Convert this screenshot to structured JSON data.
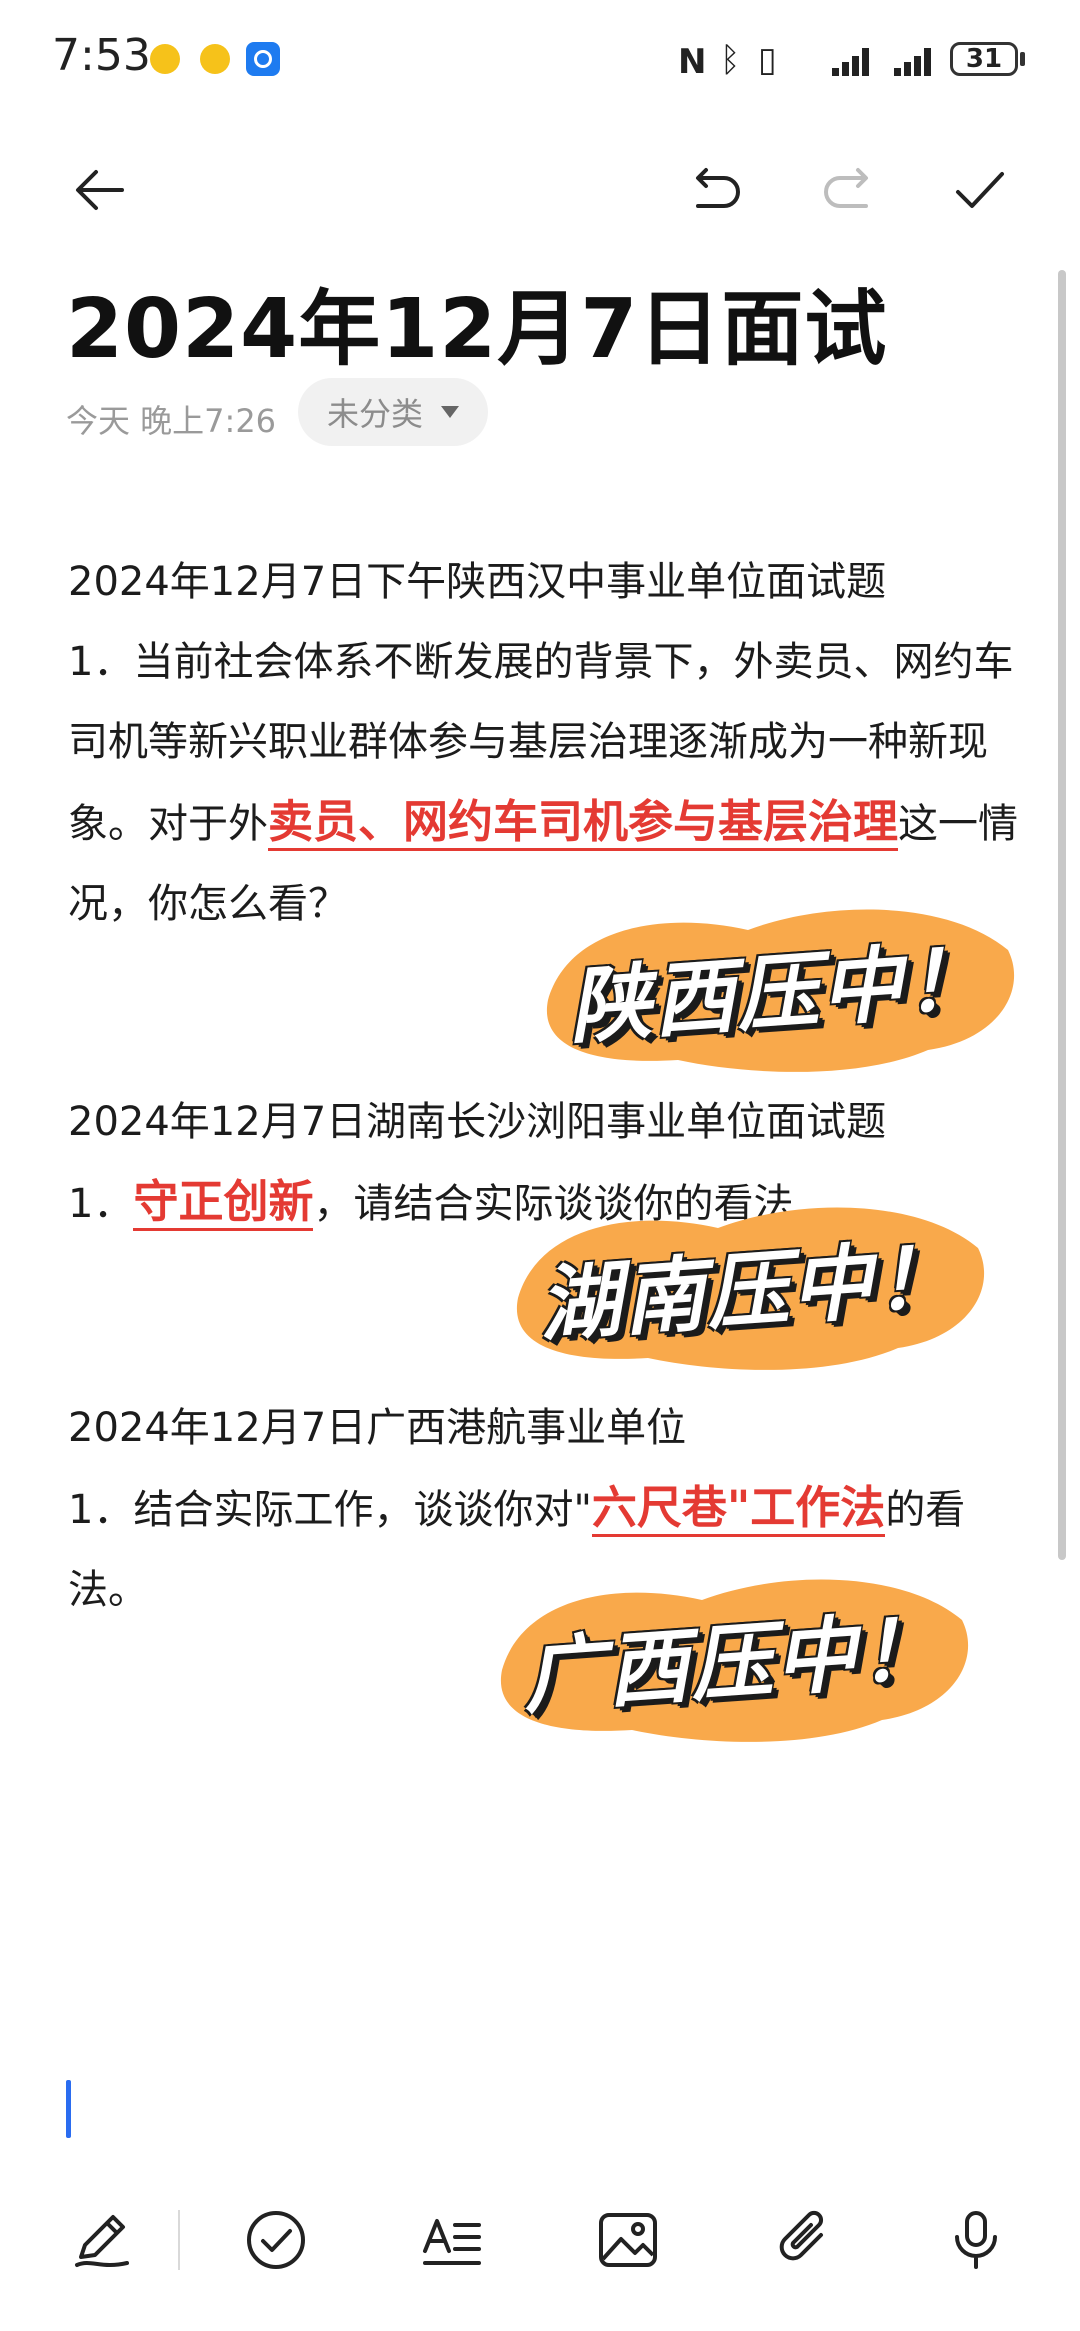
{
  "status_bar": {
    "time": "7:53",
    "battery": "31",
    "icons": [
      "app-notification-icon",
      "app-notification-icon",
      "app-browser-icon",
      "nfc-icon",
      "bluetooth-icon",
      "vibrate-icon",
      "signal-icon",
      "signal-icon",
      "battery-icon"
    ]
  },
  "toolbar": {
    "icons": [
      "back-arrow-icon",
      "undo-icon",
      "redo-icon",
      "check-icon"
    ]
  },
  "note": {
    "title": "2024年12月7日面试",
    "timestamp": "今天 晚上7:26",
    "category": "未分类",
    "sections": [
      {
        "heading": "2024年12月7日下午陕西汉中事业单位面试题",
        "q_pre": "1．当前社会体系不断发展的背景下，外卖员、网约车司机等新兴职业群体参与基层治理逐渐成为一种新现象。对于外",
        "q_highlight": "卖员、网约车司机参与基层治理",
        "q_post": "这一情况，你怎么看？",
        "sticker": "陕西压中！"
      },
      {
        "heading": "2024年12月7日湖南长沙浏阳事业单位面试题",
        "q_pre": "1．",
        "q_highlight": "守正创新",
        "q_post": "，请结合实际谈谈你的看法",
        "sticker": "湖南压中！"
      },
      {
        "heading": "2024年12月7日广西港航事业单位",
        "q_pre": "1．结合实际工作，谈谈你对\"",
        "q_highlight": "六尺巷\"工作法",
        "q_post": "的看法。",
        "sticker": "广西压中！"
      }
    ]
  },
  "bottom_tools": {
    "icons": [
      "handwriting-pen-icon",
      "checklist-icon",
      "text-format-icon",
      "insert-image-icon",
      "attachment-icon",
      "microphone-icon"
    ]
  },
  "colors": {
    "highlight": "#e43a33",
    "sticker": "#f9a94b",
    "caret": "#2a6cf0"
  }
}
